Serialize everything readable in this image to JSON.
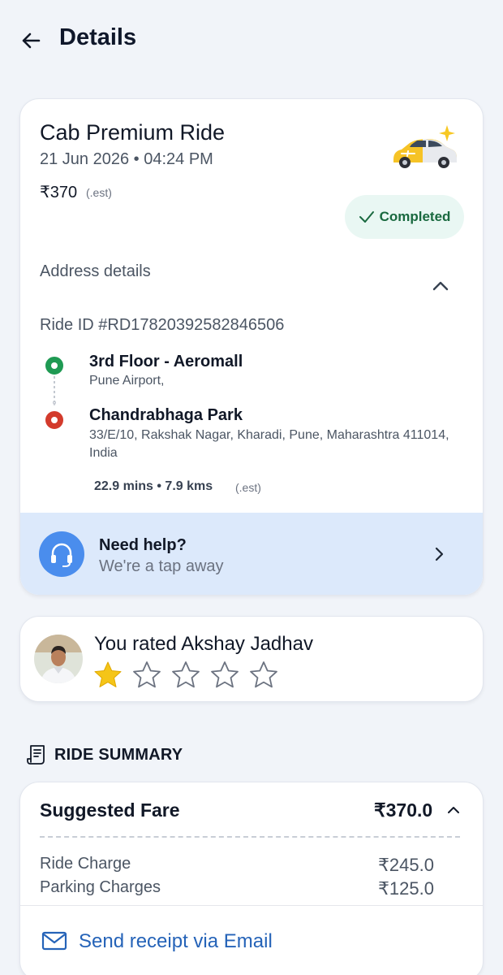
{
  "header": {
    "title": "Details",
    "back_icon": "arrow-left-icon"
  },
  "ride": {
    "title": "Cab Premium Ride",
    "date_time": "21 Jun 2026 • 04:24 PM",
    "price": "₹370",
    "price_note": "(.est)",
    "status": "Completed",
    "status_color": "#19693f",
    "address_heading": "Address details",
    "ride_id": "Ride ID #RD17820392582846506",
    "pickup": {
      "name": "3rd Floor - Aeromall",
      "address": "Pune Airport,"
    },
    "drop": {
      "name": "Chandrabhaga Park",
      "address": "33/E/10, Rakshak Nagar, Kharadi, Pune, Maharashtra 411014, India"
    },
    "trip_meta": "22.9 mins • 7.9 kms",
    "trip_meta_note": "(.est)"
  },
  "help": {
    "title": "Need help?",
    "subtitle": "We're a tap away",
    "accent": "#4a8ded"
  },
  "rating": {
    "text": "You rated Akshay Jadhav",
    "stars_filled": 1,
    "stars_total": 5
  },
  "summary": {
    "heading": "RIDE SUMMARY",
    "fare_label": "Suggested Fare",
    "fare_total": "₹370.0",
    "rows": [
      {
        "label": "Ride Charge",
        "value": "₹245.0"
      },
      {
        "label": "Parking Charges",
        "value": "₹125.0"
      }
    ],
    "email_label": "Send receipt via Email",
    "email_color": "#2563b8"
  }
}
